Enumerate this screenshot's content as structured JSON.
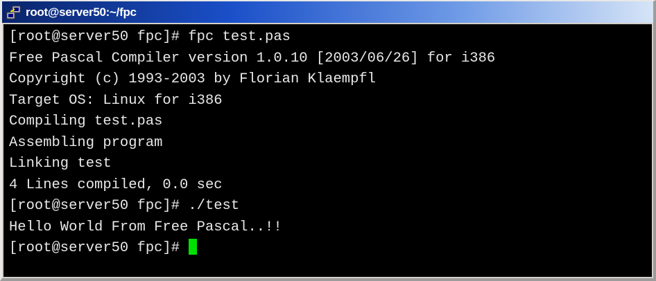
{
  "window": {
    "title": "root@server50:~/fpc",
    "icon": "putty-terminal-icon"
  },
  "terminal": {
    "lines": [
      "[root@server50 fpc]# fpc test.pas",
      "Free Pascal Compiler version 1.0.10 [2003/06/26] for i386",
      "Copyright (c) 1993-2003 by Florian Klaempfl",
      "Target OS: Linux for i386",
      "Compiling test.pas",
      "Assembling program",
      "Linking test",
      "4 Lines compiled, 0.0 sec",
      "[root@server50 fpc]# ./test",
      "Hello World From Free Pascal..!!"
    ],
    "prompt": "[root@server50 fpc]# ",
    "colors": {
      "background": "#000000",
      "text": "#e8e8e8",
      "cursor": "#00e000"
    }
  }
}
